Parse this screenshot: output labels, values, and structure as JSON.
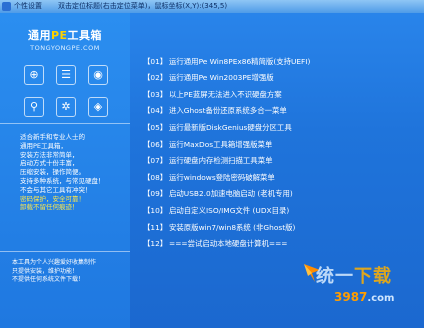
{
  "window": {
    "title_left": "个性设置",
    "title_main": "双击定位标题(右击定位菜单)，鼠标坐标(X,Y):(345,5)"
  },
  "sidebar": {
    "logo_main_prefix": "通用",
    "logo_main_pe": "PE",
    "logo_main_suffix": "工具箱",
    "logo_sub": "TONGYONGPE.COM",
    "description_lines": [
      "适合新手和专业人士的",
      "通用PE工具箱，",
      "安装方法非常简单，",
      "启动方式十份丰富，",
      "压缩安装，操作简便。",
      "支持多种系统，与常见硬盘！",
      "不会与其它工具有冲突！",
      "密码保护，安全可靠！",
      "卸载不留任何痕迹！"
    ],
    "footer_lines": [
      "本工具为个人兴趣爱好收集制作",
      "只提供安装，维护功能！",
      "不提供任何系统文件下载！"
    ]
  },
  "menu": {
    "items": [
      {
        "num": "【01】",
        "label": "运行通用Pe Win8PEx86精简版(支持UEFI)"
      },
      {
        "num": "【02】",
        "label": "运行通用Pe Win2003PE增强版"
      },
      {
        "num": "【03】",
        "label": "以上PE蓝屏无法进入不识硬盘方案"
      },
      {
        "num": "【04】",
        "label": "进入Ghost备份还原系统多合一菜单"
      },
      {
        "num": "【05】",
        "label": "运行最新版DiskGenius硬盘分区工具"
      },
      {
        "num": "【06】",
        "label": "运行MaxDos工具箱增强版菜单"
      },
      {
        "num": "【07】",
        "label": "运行硬盘内存检测扫描工具菜单"
      },
      {
        "num": "【08】",
        "label": "运行windows登陆密码破解菜单"
      },
      {
        "num": "【09】",
        "label": "启动USB2.0加速电脑启动 (老机专用)"
      },
      {
        "num": "【10】",
        "label": "启动自定义ISO/IMG文件 (UDX目录)"
      },
      {
        "num": "【11】",
        "label": "安装原版win7/win8系统 (非Ghost版)"
      },
      {
        "num": "【12】",
        "label": "===尝试启动本地硬盘计算机==="
      }
    ]
  },
  "watermark": {
    "text_a": "统一",
    "text_b": "下载",
    "number": "3987",
    "suffix": ".com"
  },
  "icons": [
    "network-icon",
    "settings-icon",
    "lock-icon",
    "usb-icon",
    "gear-icon",
    "shield-icon"
  ]
}
